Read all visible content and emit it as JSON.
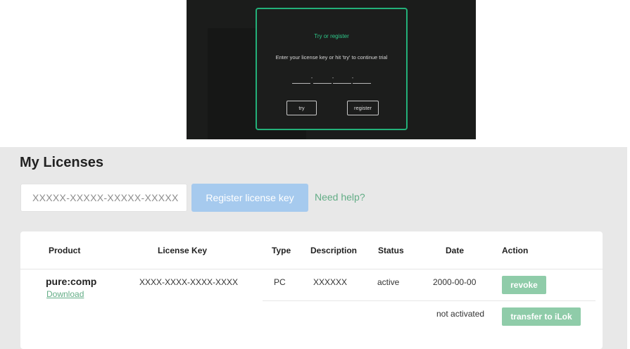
{
  "plugin_dialog": {
    "title": "Try or register",
    "prompt": "Enter your license key or hit 'try' to continue trial",
    "key_separator": "-",
    "try_label": "try",
    "register_label": "register",
    "accent_color": "#23b079"
  },
  "licenses": {
    "heading": "My Licenses",
    "key_input_placeholder": "XXXXX-XXXXX-XXXXX-XXXXX",
    "register_button_label": "Register license key",
    "help_link": "Need help?",
    "columns": [
      "Product",
      "License Key",
      "Type",
      "Description",
      "Status",
      "Date",
      "Action"
    ],
    "row": {
      "product": "pure:comp",
      "download_link": "Download",
      "license_key": "XXXX-XXXX-XXXX-XXXX",
      "type": "PC",
      "description": "XXXXXX",
      "status": "active",
      "date": "2000-00-00",
      "revoke_label": "revoke",
      "not_activated": "not activated",
      "transfer_label": "transfer to iLok"
    },
    "colors": {
      "accent_green": "#63ad86",
      "button_green": "#8fcca9",
      "register_blue": "#a6caee"
    }
  }
}
